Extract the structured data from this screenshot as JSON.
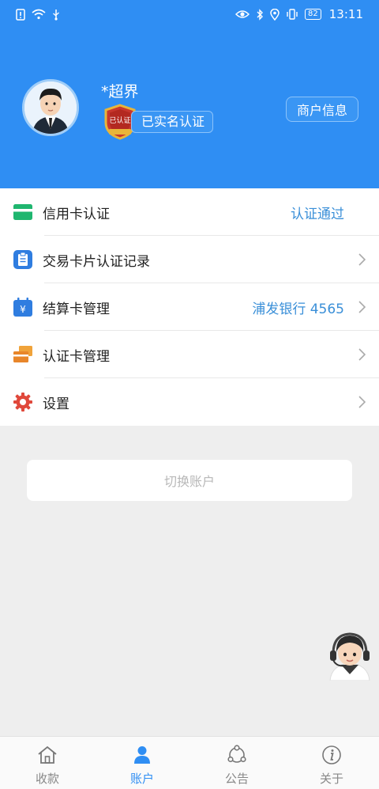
{
  "status_bar": {
    "time": "13:11",
    "battery": "82"
  },
  "profile": {
    "username": "*超界",
    "badge_text": "已认证",
    "verified_label": "已实名认证",
    "merchant_button": "商户信息"
  },
  "menu": [
    {
      "label": "信用卡认证",
      "value": "认证通过",
      "icon": "credit-card-icon"
    },
    {
      "label": "交易卡片认证记录",
      "value": "",
      "icon": "clipboard-icon"
    },
    {
      "label": "结算卡管理",
      "value": "浦发银行 4565",
      "icon": "calendar-yen-icon"
    },
    {
      "label": "认证卡管理",
      "value": "",
      "icon": "cards-icon"
    },
    {
      "label": "设置",
      "value": "",
      "icon": "gear-icon"
    }
  ],
  "switch_account": "切换账户",
  "tabs": [
    {
      "label": "收款",
      "icon": "home-icon"
    },
    {
      "label": "账户",
      "icon": "person-icon"
    },
    {
      "label": "公告",
      "icon": "share-icon"
    },
    {
      "label": "关于",
      "icon": "info-icon"
    }
  ],
  "active_tab": "账户",
  "colors": {
    "primary": "#2f8ef3",
    "link": "#3a8fd8",
    "background": "#eeeeee"
  }
}
